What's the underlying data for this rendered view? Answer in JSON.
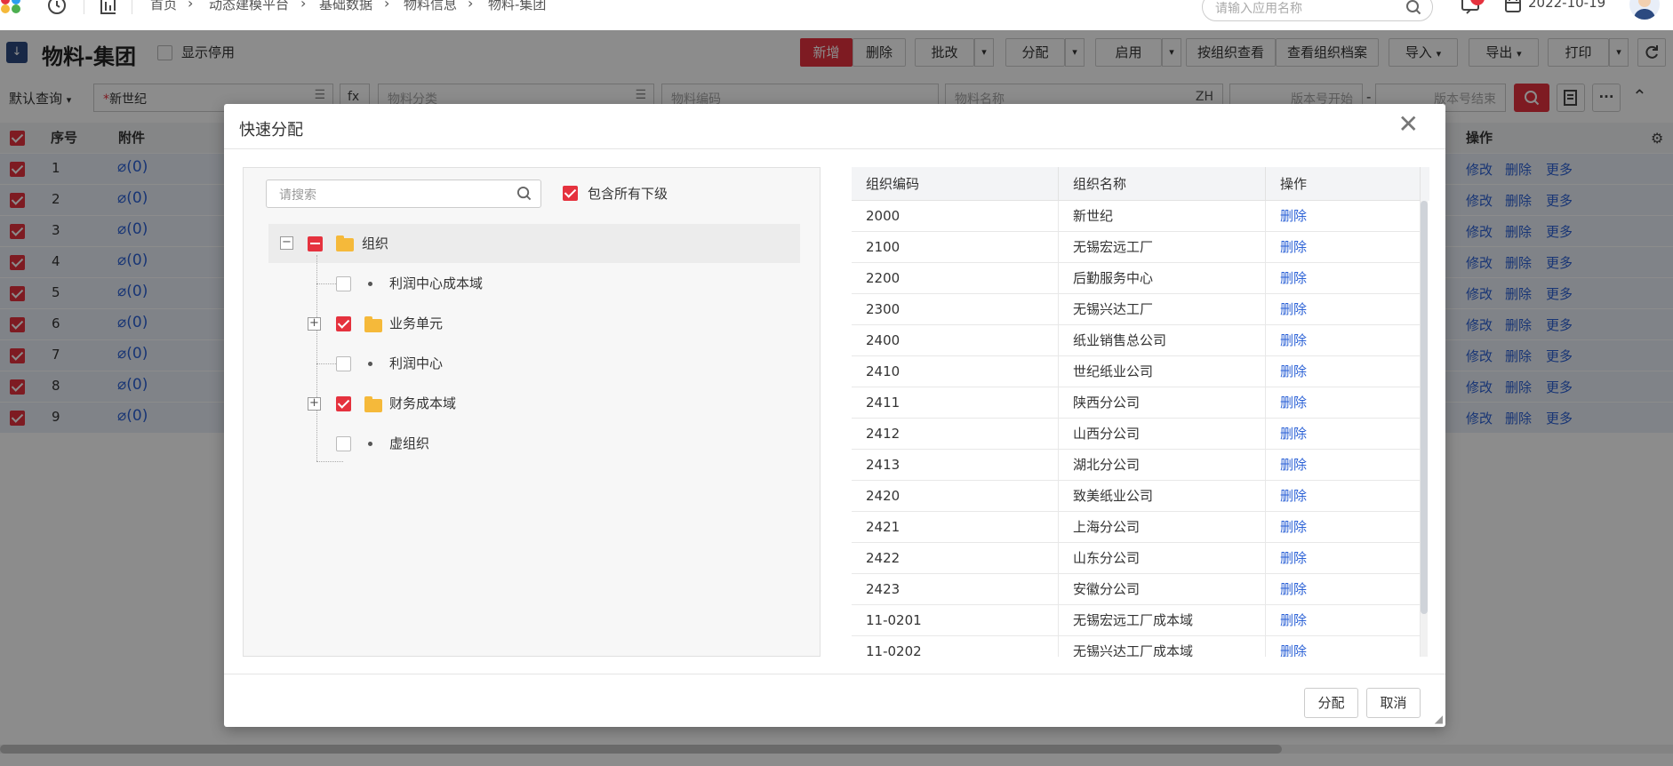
{
  "topnav": {
    "breadcrumbs": [
      "首页",
      "动态建模平台",
      "基础数据",
      "物料信息",
      "物料-集团"
    ],
    "app_search_placeholder": "请输入应用名称",
    "date": "2022-10-19"
  },
  "header": {
    "title": "物料-集团",
    "show_disabled_label": "显示停用",
    "buttons": {
      "new": "新增",
      "delete": "删除",
      "batch_edit": "批改",
      "assign": "分配",
      "enable": "启用",
      "view_by_org": "按组织查看",
      "view_org_archive": "查看组织档案",
      "import": "导入",
      "export": "导出",
      "print": "打印"
    }
  },
  "filters": {
    "query_mode": "默认查询",
    "org_value": "新世纪",
    "fx": "fx",
    "material_category_placeholder": "物料分类",
    "material_code_placeholder": "物料编码",
    "material_name_placeholder": "物料名称",
    "lang_tag": "ZH",
    "version_start_placeholder": "版本号开始",
    "version_dash": "-",
    "version_end_placeholder": "版本号结束"
  },
  "grid": {
    "headers": {
      "seq": "序号",
      "attachment": "附件",
      "ops": "操作"
    },
    "rows": [
      {
        "seq": "1",
        "attachment": "(0)"
      },
      {
        "seq": "2",
        "attachment": "(0)"
      },
      {
        "seq": "3",
        "attachment": "(0)"
      },
      {
        "seq": "4",
        "attachment": "(0)"
      },
      {
        "seq": "5",
        "attachment": "(0)"
      },
      {
        "seq": "6",
        "attachment": "(0)"
      },
      {
        "seq": "7",
        "attachment": "(0)"
      },
      {
        "seq": "8",
        "attachment": "(0)"
      },
      {
        "seq": "9",
        "attachment": "(0)"
      }
    ],
    "row_actions": {
      "edit": "修改",
      "delete": "删除",
      "more": "更多"
    }
  },
  "modal": {
    "title": "快速分配",
    "search_placeholder": "请搜索",
    "include_children_label": "包含所有下级",
    "tree": {
      "root": "组织",
      "children": [
        {
          "label": "利润中心成本域",
          "checked": false,
          "expandable": false
        },
        {
          "label": "业务单元",
          "checked": true,
          "expandable": true
        },
        {
          "label": "利润中心",
          "checked": false,
          "expandable": false
        },
        {
          "label": "财务成本域",
          "checked": true,
          "expandable": true
        },
        {
          "label": "虚组织",
          "checked": false,
          "expandable": false
        }
      ]
    },
    "table": {
      "headers": [
        "组织编码",
        "组织名称",
        "操作"
      ],
      "delete_label": "删除",
      "rows": [
        {
          "code": "2000",
          "name": "新世纪"
        },
        {
          "code": "2100",
          "name": "无锡宏远工厂"
        },
        {
          "code": "2200",
          "name": "后勤服务中心"
        },
        {
          "code": "2300",
          "name": "无锡兴达工厂"
        },
        {
          "code": "2400",
          "name": "纸业销售总公司"
        },
        {
          "code": "2410",
          "name": "世纪纸业公司"
        },
        {
          "code": "2411",
          "name": "陕西分公司"
        },
        {
          "code": "2412",
          "name": "山西分公司"
        },
        {
          "code": "2413",
          "name": "湖北分公司"
        },
        {
          "code": "2420",
          "name": "致美纸业公司"
        },
        {
          "code": "2421",
          "name": "上海分公司"
        },
        {
          "code": "2422",
          "name": "山东分公司"
        },
        {
          "code": "2423",
          "name": "安徽分公司"
        },
        {
          "code": "11-0201",
          "name": "无锡宏远工厂成本域"
        },
        {
          "code": "11-0202",
          "name": "无锡兴达工厂成本域"
        }
      ]
    },
    "footer": {
      "assign": "分配",
      "cancel": "取消"
    }
  },
  "colors": {
    "accent": "#e5323e",
    "link": "#2c62d6",
    "folder": "#f5b93a"
  }
}
